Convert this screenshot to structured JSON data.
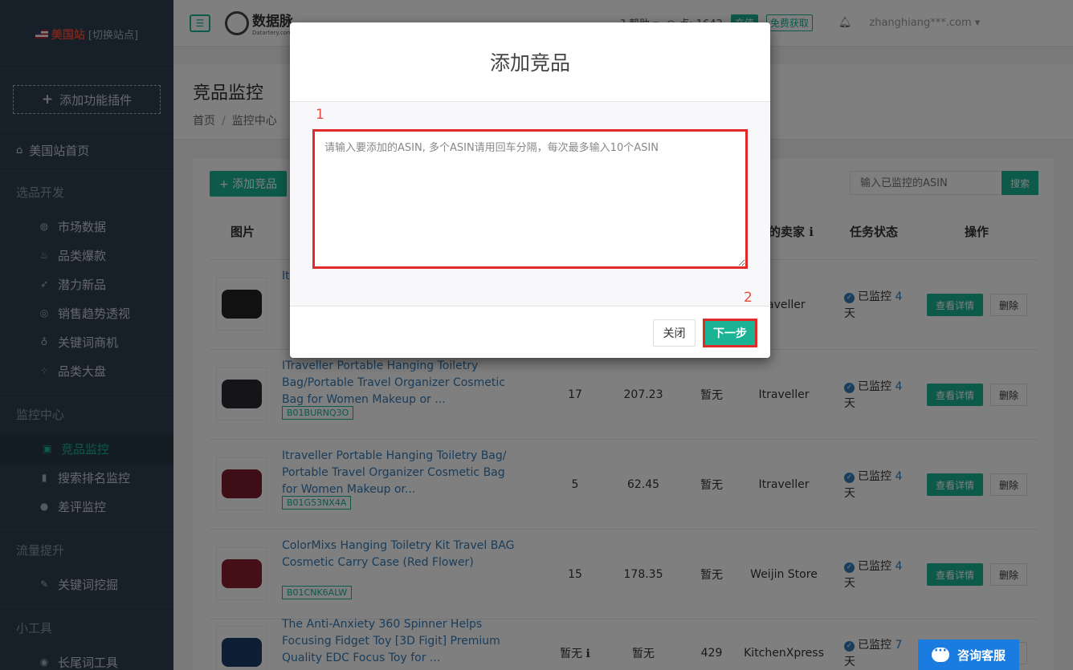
{
  "sidebar": {
    "site_name": "美国站",
    "site_change": "[切换站点]",
    "add_plugin": "添加功能插件",
    "home": "美国站首页",
    "groups": [
      {
        "title": "选品开发",
        "items": [
          {
            "label": "市场数据",
            "icon": "globe-icon",
            "glyph": "◍"
          },
          {
            "label": "品类爆款",
            "icon": "fire-icon",
            "glyph": "♨"
          },
          {
            "label": "潜力新品",
            "icon": "rocket-icon",
            "glyph": "➶"
          },
          {
            "label": "销售趋势透视",
            "icon": "target-icon",
            "glyph": "◎"
          },
          {
            "label": "关键词商机",
            "icon": "bulb-icon",
            "glyph": "♁"
          },
          {
            "label": "品类大盘",
            "icon": "grid-icon",
            "glyph": "⁘"
          }
        ]
      },
      {
        "title": "监控中心",
        "items": [
          {
            "label": "竞品监控",
            "icon": "monitor-icon",
            "glyph": "▣",
            "active": true
          },
          {
            "label": "搜索排名监控",
            "icon": "bar-chart-icon",
            "glyph": "▮"
          },
          {
            "label": "差评监控",
            "icon": "comment-icon",
            "glyph": "●"
          }
        ]
      },
      {
        "title": "流量提升",
        "items": [
          {
            "label": "关键词挖掘",
            "icon": "pencil-icon",
            "glyph": "✎"
          }
        ]
      },
      {
        "title": "小工具",
        "items": [
          {
            "label": "长尾词工具",
            "icon": "circle-icon",
            "glyph": "◉"
          }
        ]
      }
    ]
  },
  "topbar": {
    "logo_text": "数据脉",
    "logo_sub": "Datartery.com",
    "help": "帮助",
    "points": "点: 1643",
    "recharge": "充值",
    "free": "免费获取",
    "user": "zhanghiang***.com"
  },
  "page": {
    "title": "竞品监控",
    "breadcrumb": [
      "首页",
      "监控中心"
    ]
  },
  "toolbar": {
    "add_label": "+ 添加竞品",
    "search_placeholder": "输入已监控的ASIN",
    "search_button": "搜索"
  },
  "table": {
    "headers": {
      "image": "图片",
      "seller": "的卖家",
      "status": "任务状态",
      "action": "操作"
    },
    "detail_label": "查看详情",
    "delete_label": "删除",
    "rows": [
      {
        "title": "It... B... P...",
        "asin": "",
        "c1": "",
        "c2": "",
        "c3": "",
        "seller": "raveller",
        "status_prefix": "已监控",
        "days": "4",
        "day_unit": "天",
        "bag_color": "#222"
      },
      {
        "title": "ITraveller Portable Hanging Toiletry Bag/Portable Travel Organizer Cosmetic Bag for Women Makeup or ...",
        "asin": "B01BURNQ3O",
        "c1": "17",
        "c2": "207.23",
        "c3": "暂无",
        "seller": "Itraveller",
        "status_prefix": "已监控",
        "days": "4",
        "day_unit": "天",
        "bag_color": "#2b2b33"
      },
      {
        "title": "Itraveller Portable Hanging Toiletry Bag/ Portable Travel Organizer Cosmetic Bag for Women Makeup or...",
        "asin": "B01G53NX4A",
        "c1": "5",
        "c2": "62.45",
        "c3": "暂无",
        "seller": "Itraveller",
        "status_prefix": "已监控",
        "days": "4",
        "day_unit": "天",
        "bag_color": "#7a1c2a"
      },
      {
        "title": "ColorMixs Hanging Toiletry Kit Travel BAG Cosmetic Carry Case (Red Flower)",
        "asin": "B01CNK6ALW",
        "c1": "15",
        "c2": "178.35",
        "c3": "暂无",
        "seller": "Weijin Store",
        "status_prefix": "已监控",
        "days": "4",
        "day_unit": "天",
        "bag_color": "#8a1e30"
      },
      {
        "title": "The Anti-Anxiety 360 Spinner Helps Focusing Fidget Toy [3D Figit] Premium Quality EDC Focus Toy for ...",
        "asin": "",
        "c1": "暂无 ℹ",
        "c2": "暂无",
        "c3": "429",
        "seller": "KitchenXpress",
        "status_prefix": "已监控",
        "days": "7",
        "day_unit": "天",
        "bag_color": "#1d3d6b"
      }
    ]
  },
  "modal": {
    "title": "添加竞品",
    "annotation_1": "1",
    "annotation_2": "2",
    "textarea_placeholder": "请输入要添加的ASIN, 多个ASIN请用回车分隔，每次最多输入10个ASIN",
    "close_label": "关闭",
    "next_label": "下一步"
  },
  "chat": {
    "label": "咨询客服"
  },
  "colors": {
    "primary": "#1ab394",
    "sidebar_bg": "#2f4050",
    "annotation": "#e02b27",
    "link": "#337ab7"
  }
}
